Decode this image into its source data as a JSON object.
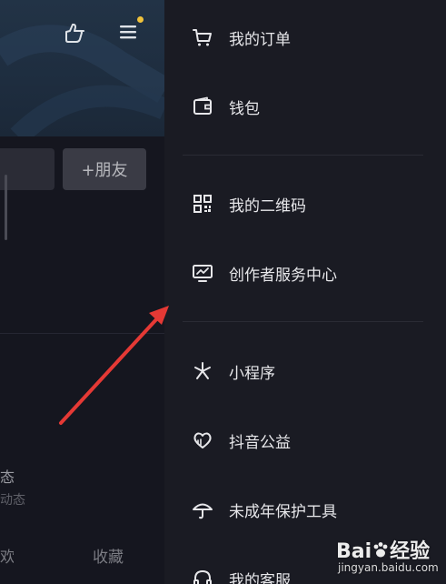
{
  "left_panel": {
    "add_friend_label": "+朋友",
    "dynamic_title": "态",
    "dynamic_subtitle": "动态",
    "tab_like_partial": "欢",
    "tab_favorites": "收藏",
    "accent_dot_color": "#f0c23b"
  },
  "drawer": {
    "items": [
      {
        "label": "我的订单",
        "icon": "cart-icon"
      },
      {
        "label": "钱包",
        "icon": "wallet-icon"
      },
      {
        "label": "我的二维码",
        "icon": "qr-code-icon"
      },
      {
        "label": "创作者服务中心",
        "icon": "creator-monitor-icon"
      },
      {
        "label": "小程序",
        "icon": "mini-program-icon"
      },
      {
        "label": "抖音公益",
        "icon": "charity-heart-icon"
      },
      {
        "label": "未成年保护工具",
        "icon": "umbrella-icon"
      },
      {
        "label": "我的客服",
        "icon": "headset-icon"
      }
    ]
  },
  "annotation": {
    "arrow_color": "#e53935"
  },
  "watermark": {
    "brand": "Bai",
    "brand_suffix": "经验",
    "url": "jingyan.baidu.com"
  }
}
